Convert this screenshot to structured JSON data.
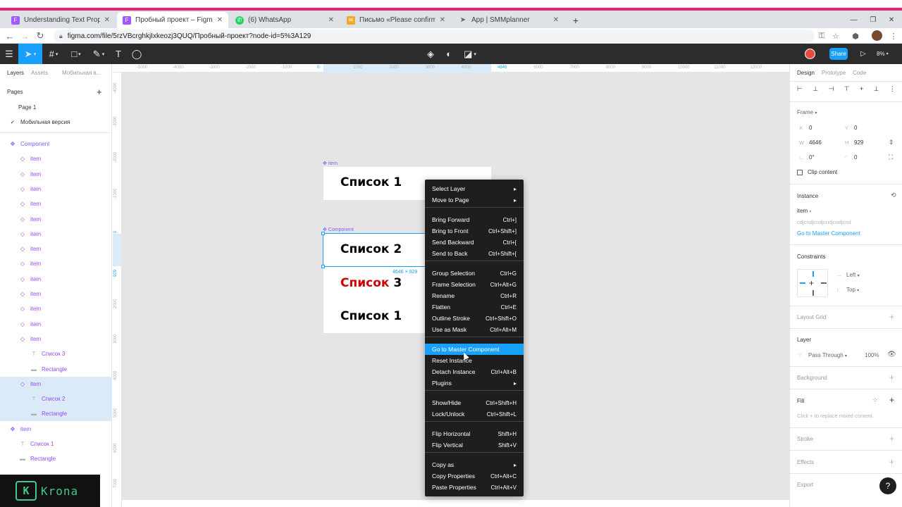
{
  "browser": {
    "tabs": [
      {
        "label": "Understanding Text Properties – F",
        "close": "✕"
      },
      {
        "label": "Пробный проект – Figma",
        "close": "✕"
      },
      {
        "label": "(6) WhatsApp",
        "close": "✕"
      },
      {
        "label": "Письмо «Please confirm your e",
        "close": "✕"
      },
      {
        "label": "App | SMMplanner",
        "close": "✕"
      }
    ],
    "new_tab": "+",
    "url": "figma.com/file/5rzVBcrghkjIxkeozj3QUQ/Пробный-проект?node-id=5%3A129",
    "colors": {
      "accent_stripe": "#e5236f"
    }
  },
  "toolbar": {
    "share_label": "Share",
    "zoom": "8%",
    "accent": "#18a0fb"
  },
  "left_panel": {
    "tabs": [
      "Layers",
      "Assets",
      "Мобильная в..."
    ],
    "pages_label": "Pages",
    "add": "+",
    "pages": [
      "Page 1",
      "Мобильная версия"
    ],
    "check": "✓",
    "layers": [
      {
        "label": "Component",
        "type": "component"
      },
      {
        "label": "item",
        "type": "instance"
      },
      {
        "label": "item",
        "type": "instance"
      },
      {
        "label": "item",
        "type": "instance"
      },
      {
        "label": "item",
        "type": "instance"
      },
      {
        "label": "item",
        "type": "instance"
      },
      {
        "label": "item",
        "type": "instance"
      },
      {
        "label": "item",
        "type": "instance"
      },
      {
        "label": "item",
        "type": "instance"
      },
      {
        "label": "item",
        "type": "instance"
      },
      {
        "label": "item",
        "type": "instance"
      },
      {
        "label": "item",
        "type": "instance"
      },
      {
        "label": "item",
        "type": "instance"
      },
      {
        "label": "item",
        "type": "instance"
      },
      {
        "label": "Список 3",
        "type": "text"
      },
      {
        "label": "Rectangle",
        "type": "rect"
      },
      {
        "label": "item",
        "type": "instance"
      },
      {
        "label": "Список 2",
        "type": "text"
      },
      {
        "label": "Rectangle",
        "type": "rect"
      },
      {
        "label": "item",
        "type": "component"
      },
      {
        "label": "Список 1",
        "type": "text"
      },
      {
        "label": "Rectangle",
        "type": "rect"
      }
    ]
  },
  "ruler": {
    "top": [
      "-5000",
      "-4000",
      "-3000",
      "-2000",
      "-1000",
      "0",
      "1000",
      "2000",
      "3000",
      "4000",
      "4646",
      "6000",
      "7000",
      "8000",
      "9000",
      "10000",
      "11000",
      "12000"
    ],
    "left": [
      "-4000",
      "-3000",
      "-2000",
      "-1000",
      "0",
      "929",
      "2000",
      "3000",
      "4000",
      "5000",
      "6000",
      "7000"
    ]
  },
  "canvas": {
    "frame1_label": "item",
    "frame2_label": "Component",
    "texts": {
      "l1": "Список 1",
      "l2": "Список 2",
      "l3_red": "Список",
      "l3_rest": " 3",
      "l4": "Список 1"
    },
    "dim": "4646 × 929",
    "colors": {
      "red_text": "#d00000",
      "component_purple": "#7b61ff"
    }
  },
  "context_menu": {
    "items": [
      {
        "label": "Select Layer",
        "shortcut": "▸"
      },
      {
        "label": "Move to Page",
        "shortcut": "▸"
      },
      {
        "label": "Bring Forward",
        "shortcut": "Ctrl+]"
      },
      {
        "label": "Bring to Front",
        "shortcut": "Ctrl+Shift+]"
      },
      {
        "label": "Send Backward",
        "shortcut": "Ctrl+["
      },
      {
        "label": "Send to Back",
        "shortcut": "Ctrl+Shift+["
      },
      {
        "label": "Group Selection",
        "shortcut": "Ctrl+G"
      },
      {
        "label": "Frame Selection",
        "shortcut": "Ctrl+Alt+G"
      },
      {
        "label": "Rename",
        "shortcut": "Ctrl+R"
      },
      {
        "label": "Flatten",
        "shortcut": "Ctrl+E"
      },
      {
        "label": "Outline Stroke",
        "shortcut": "Ctrl+Shift+O"
      },
      {
        "label": "Use as Mask",
        "shortcut": "Ctrl+Alt+M"
      },
      {
        "label": "Go to Master Component",
        "shortcut": ""
      },
      {
        "label": "Reset Instance",
        "shortcut": ""
      },
      {
        "label": "Detach Instance",
        "shortcut": "Ctrl+Alt+B"
      },
      {
        "label": "Plugins",
        "shortcut": "▸"
      },
      {
        "label": "Show/Hide",
        "shortcut": "Ctrl+Shift+H"
      },
      {
        "label": "Lock/Unlock",
        "shortcut": "Ctrl+Shift+L"
      },
      {
        "label": "Flip Horizontal",
        "shortcut": "Shift+H"
      },
      {
        "label": "Flip Vertical",
        "shortcut": "Shift+V"
      },
      {
        "label": "Copy as",
        "shortcut": "▸"
      },
      {
        "label": "Copy Properties",
        "shortcut": "Ctrl+Alt+C"
      },
      {
        "label": "Paste Properties",
        "shortcut": "Ctrl+Alt+V"
      }
    ]
  },
  "right_panel": {
    "tabs": [
      "Design",
      "Prototype",
      "Code"
    ],
    "frame_label": "Frame",
    "x_label": "X",
    "x_value": "0",
    "y_label": "Y",
    "y_value": "0",
    "w_label": "W",
    "w_value": "4646",
    "h_label": "H",
    "h_value": "929",
    "rotation": "0°",
    "radius": "0",
    "clip_content": "Clip content",
    "instance_label": "Instance",
    "instance_name": "item",
    "instance_desc": "cdjcndjcndjcndjcndjcnd",
    "go_master": "Go to Master Component",
    "constraints_label": "Constraints",
    "constraint_h": "Left",
    "constraint_v": "Top",
    "layout_grid": "Layout Grid",
    "layer_label": "Layer",
    "blend": "Pass Through",
    "opacity": "100%",
    "background_label": "Background",
    "fill_label": "Fill",
    "fill_hint": "Click + to replace mixed content.",
    "stroke_label": "Stroke",
    "effects_label": "Effects",
    "export_label": "Export",
    "help": "?",
    "plus": "+"
  },
  "watermark": {
    "text": "Krona",
    "glyph": "K"
  }
}
